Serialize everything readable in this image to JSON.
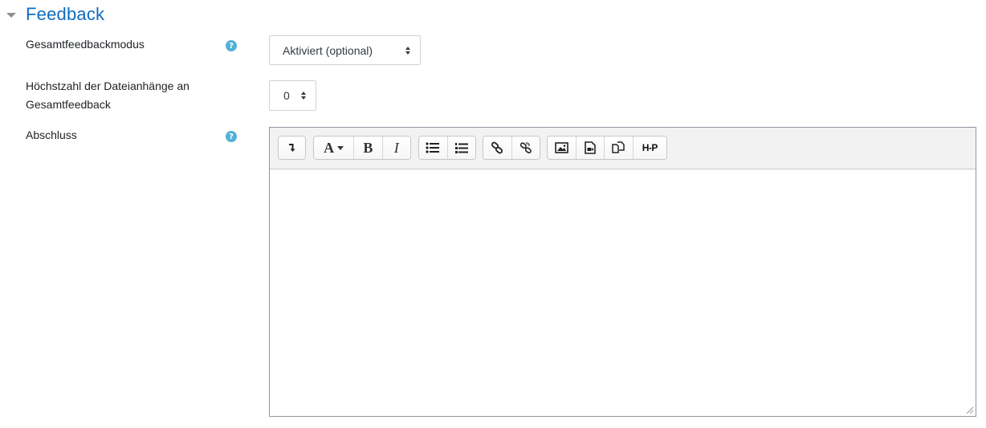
{
  "section": {
    "title": "Feedback"
  },
  "fields": {
    "feedback_mode": {
      "label": "Gesamtfeedbackmodus",
      "value": "Aktiviert (optional)"
    },
    "max_attachments": {
      "label_line1": "Höchstzahl der Dateianhänge an",
      "label_line2": "Gesamtfeedback",
      "value": "0"
    },
    "completion": {
      "label": "Abschluss"
    }
  },
  "help": {
    "glyph": "?"
  },
  "toolbar": {
    "groups": [
      [
        "toolbar-toggle-icon"
      ],
      [
        "font-style-icon",
        "bold-icon",
        "italic-icon"
      ],
      [
        "unordered-list-icon",
        "ordered-list-icon"
      ],
      [
        "link-icon",
        "unlink-icon"
      ],
      [
        "image-icon",
        "media-icon",
        "manage-files-icon",
        "h5p-icon"
      ]
    ],
    "bold": "B",
    "italic": "I",
    "font": "A",
    "h5p": "H-P"
  },
  "colors": {
    "accent": "#0f6cbf",
    "help": "#52b1d6"
  }
}
